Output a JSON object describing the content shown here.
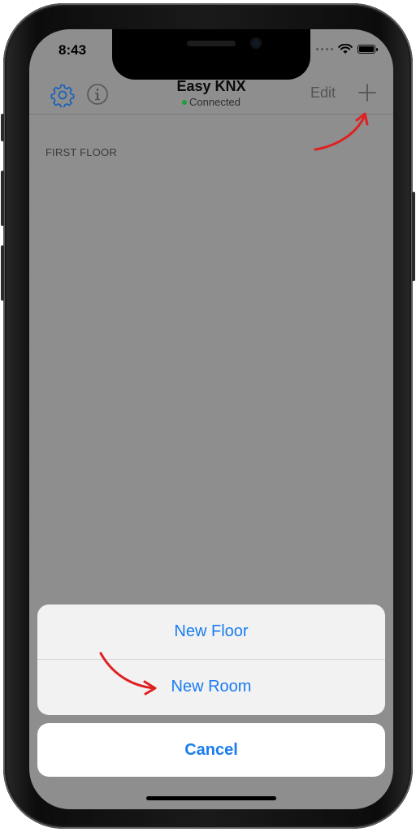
{
  "status_bar": {
    "time": "8:43",
    "icons": [
      "signal-dots-icon",
      "wifi-icon",
      "battery-icon"
    ]
  },
  "nav": {
    "title": "Easy KNX",
    "subtitle": "Connected",
    "edit_label": "Edit",
    "left_icons": [
      "gear-icon",
      "info-icon"
    ],
    "right_icon": "plus-icon"
  },
  "content": {
    "section_header": "FIRST FLOOR"
  },
  "action_sheet": {
    "items": [
      {
        "label": "New Floor"
      },
      {
        "label": "New Room"
      }
    ],
    "cancel_label": "Cancel"
  },
  "colors": {
    "accent": "#1b7cf0",
    "status_green": "#1e9e3a",
    "dim_background": "#8e8e8e",
    "annotation_red": "#e02020"
  }
}
